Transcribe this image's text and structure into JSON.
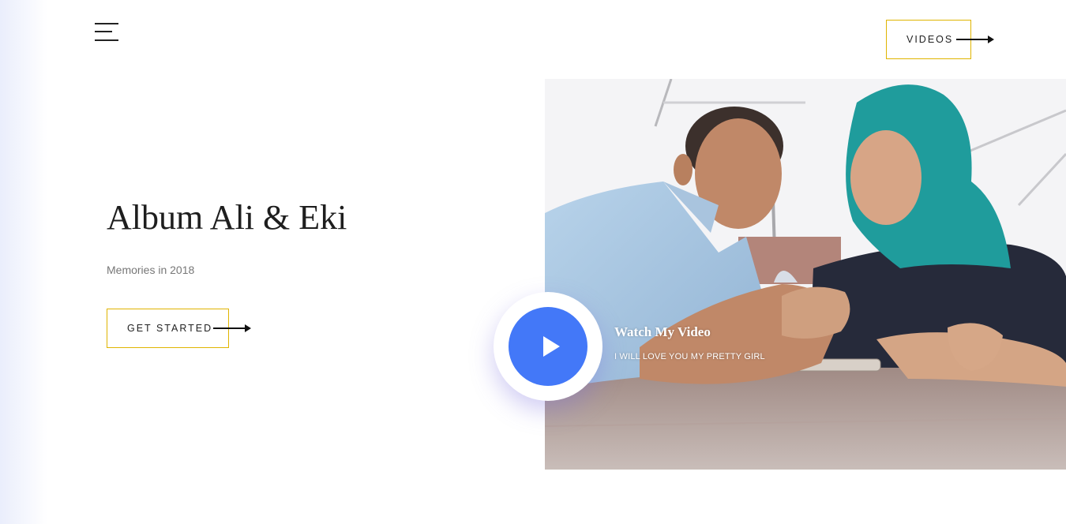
{
  "header": {
    "menu_icon": "hamburger-icon",
    "videos_label": "VIDEOS"
  },
  "hero": {
    "title": "Album Ali & Eki",
    "subtitle": "Memories in 2018",
    "cta_label": "GET STARTED"
  },
  "video": {
    "title": "Watch My Video",
    "subtitle": "I WILL LOVE YOU MY PRETTY GIRL",
    "play_icon": "play-icon"
  },
  "colors": {
    "accent_border": "#e0b400",
    "play_button": "#4378f8",
    "text_dark": "#1e1e1e",
    "text_muted": "#777777"
  }
}
